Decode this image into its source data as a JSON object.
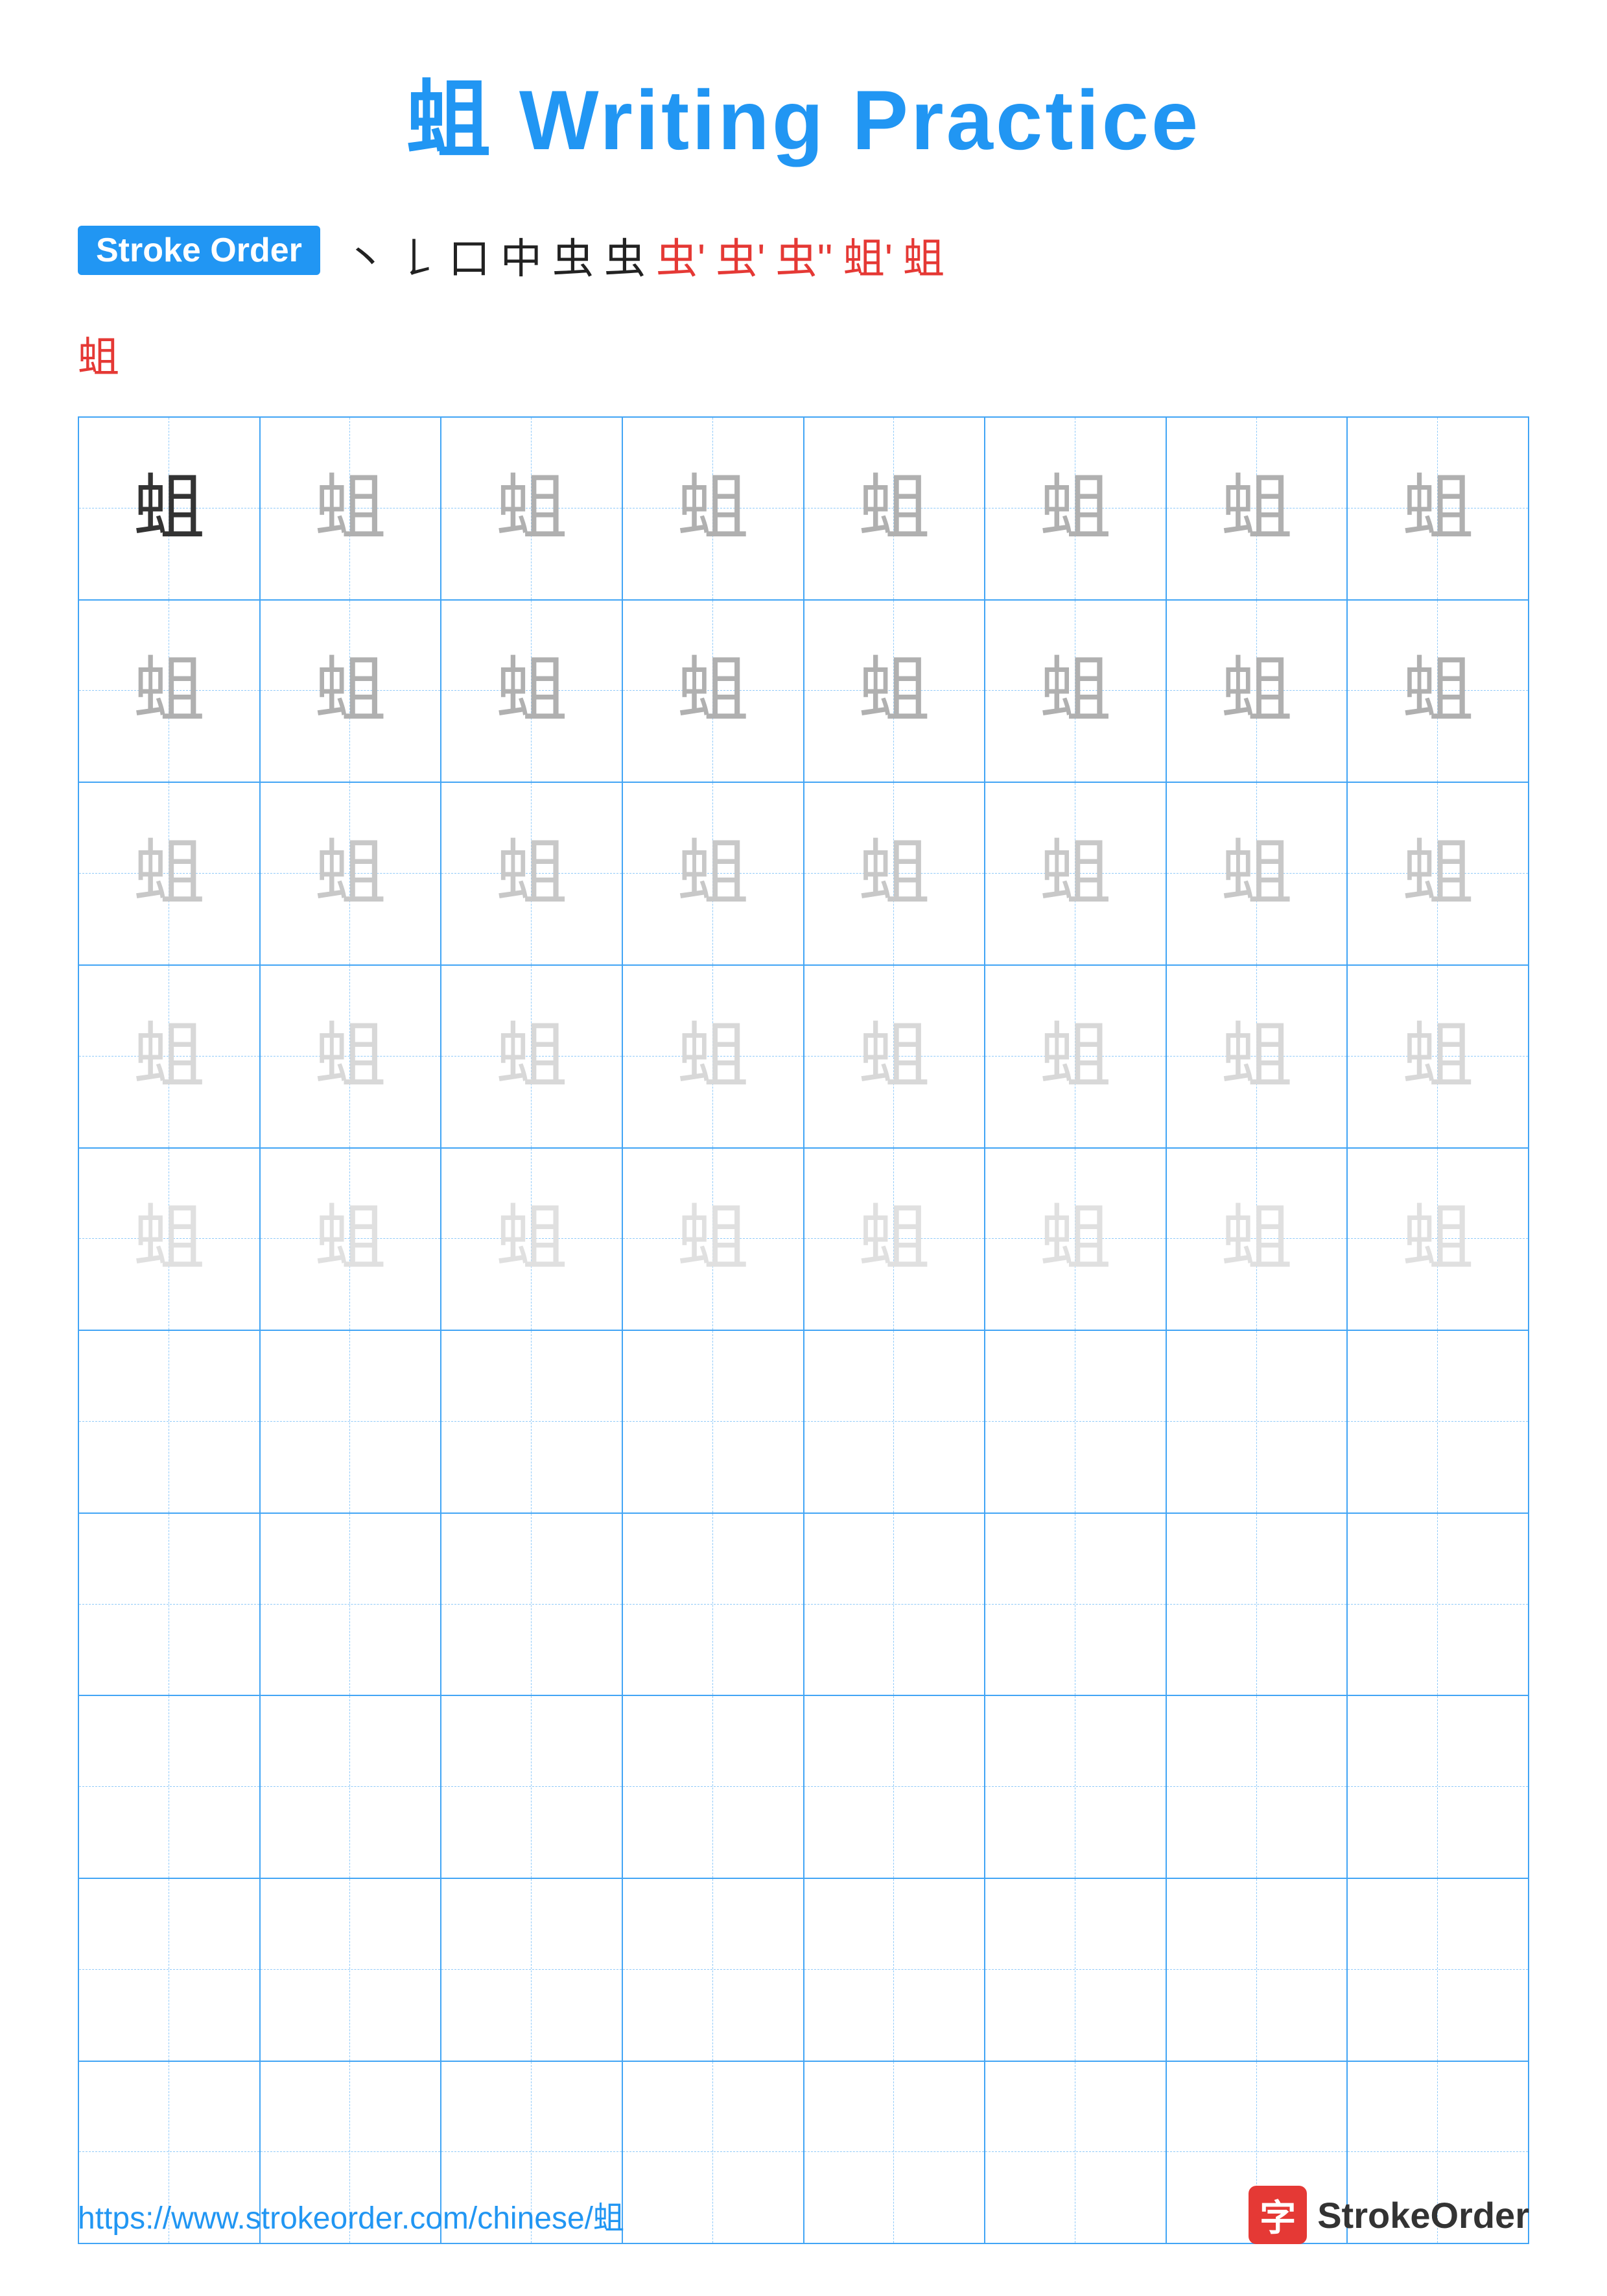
{
  "title": {
    "char": "蛆",
    "label": "Writing Practice",
    "full": "蛆 Writing Practice"
  },
  "stroke_order": {
    "label": "Stroke Order",
    "strokes": [
      "丶",
      "𠄌",
      "口",
      "中",
      "虫",
      "虫",
      "虫'",
      "虫'",
      "虫''",
      "蛆'",
      "蛆"
    ],
    "extra": "蛆"
  },
  "grid": {
    "rows": 10,
    "cols": 8,
    "character": "蛆",
    "practice_rows": [
      [
        "dark",
        "light1",
        "light1",
        "light1",
        "light1",
        "light1",
        "light1",
        "light1"
      ],
      [
        "light1",
        "light1",
        "light1",
        "light1",
        "light1",
        "light1",
        "light1",
        "light1"
      ],
      [
        "light2",
        "light2",
        "light2",
        "light2",
        "light2",
        "light2",
        "light2",
        "light2"
      ],
      [
        "light3",
        "light3",
        "light3",
        "light3",
        "light3",
        "light3",
        "light3",
        "light3"
      ],
      [
        "light4",
        "light4",
        "light4",
        "light4",
        "light4",
        "light4",
        "light4",
        "light4"
      ],
      [
        "empty",
        "empty",
        "empty",
        "empty",
        "empty",
        "empty",
        "empty",
        "empty"
      ],
      [
        "empty",
        "empty",
        "empty",
        "empty",
        "empty",
        "empty",
        "empty",
        "empty"
      ],
      [
        "empty",
        "empty",
        "empty",
        "empty",
        "empty",
        "empty",
        "empty",
        "empty"
      ],
      [
        "empty",
        "empty",
        "empty",
        "empty",
        "empty",
        "empty",
        "empty",
        "empty"
      ],
      [
        "empty",
        "empty",
        "empty",
        "empty",
        "empty",
        "empty",
        "empty",
        "empty"
      ]
    ]
  },
  "footer": {
    "url": "https://www.strokeorder.com/chinese/蛆",
    "logo_text": "StrokeOrder",
    "logo_char": "字"
  }
}
